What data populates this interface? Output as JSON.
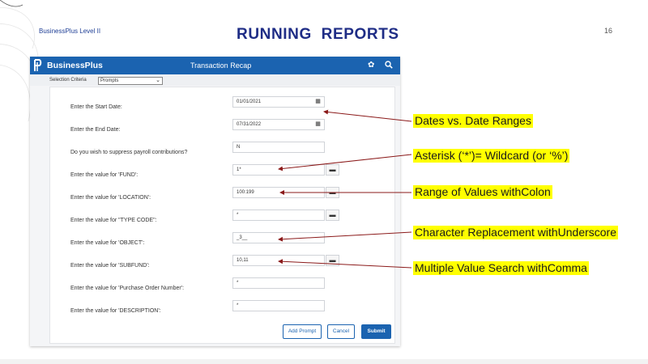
{
  "slide": {
    "brand": "BusinessPlus Level II",
    "title": "RUNNING  REPORTS",
    "page_number": "16"
  },
  "window": {
    "brand": "BusinessPlus",
    "title": "Transaction Recap",
    "selection_criteria_label": "Selection Criteria",
    "selection_criteria_value": "Prompts",
    "fields": [
      {
        "label": "Enter the Start Date:",
        "value": "01/01/2021"
      },
      {
        "label": "Enter the End Date:",
        "value": "07/31/2022"
      },
      {
        "label": "Do you wish to suppress payroll contributions?",
        "value": "N"
      },
      {
        "label": "Enter the value for 'FUND':",
        "value": "1*"
      },
      {
        "label": "Enter the value for 'LOCATION':",
        "value": "100:199"
      },
      {
        "label": "Enter the value for \"TYPE CODE\":",
        "value": "*"
      },
      {
        "label": "Enter the value for 'OBJECT':",
        "value": "_3__"
      },
      {
        "label": "Enter the value for 'SUBFUND':",
        "value": "10,11"
      },
      {
        "label": "Enter the value for 'Purchase Order Number':",
        "value": "*"
      },
      {
        "label": "Enter the value for 'DESCRIPTION':",
        "value": "*"
      }
    ],
    "buttons": {
      "add_prompt": "Add Prompt",
      "cancel": "Cancel",
      "submit": "Submit"
    }
  },
  "callouts": [
    "Dates vs. Date Ranges",
    "Asterisk (‘*’)= Wildcard (or ‘%’)",
    "Range of Values withColon",
    "Character Replacement withUnderscore",
    "Multiple  Value Search withComma"
  ],
  "colors": {
    "title": "#1f2d86",
    "titlebar": "#1b63b0",
    "highlight": "#ffff00",
    "arrow": "#8b1a1a"
  },
  "icons": [
    "businessplus-logo-icon",
    "settings-icon",
    "search-icon",
    "calendar-icon",
    "lookup-icon",
    "chevron-down-icon"
  ]
}
